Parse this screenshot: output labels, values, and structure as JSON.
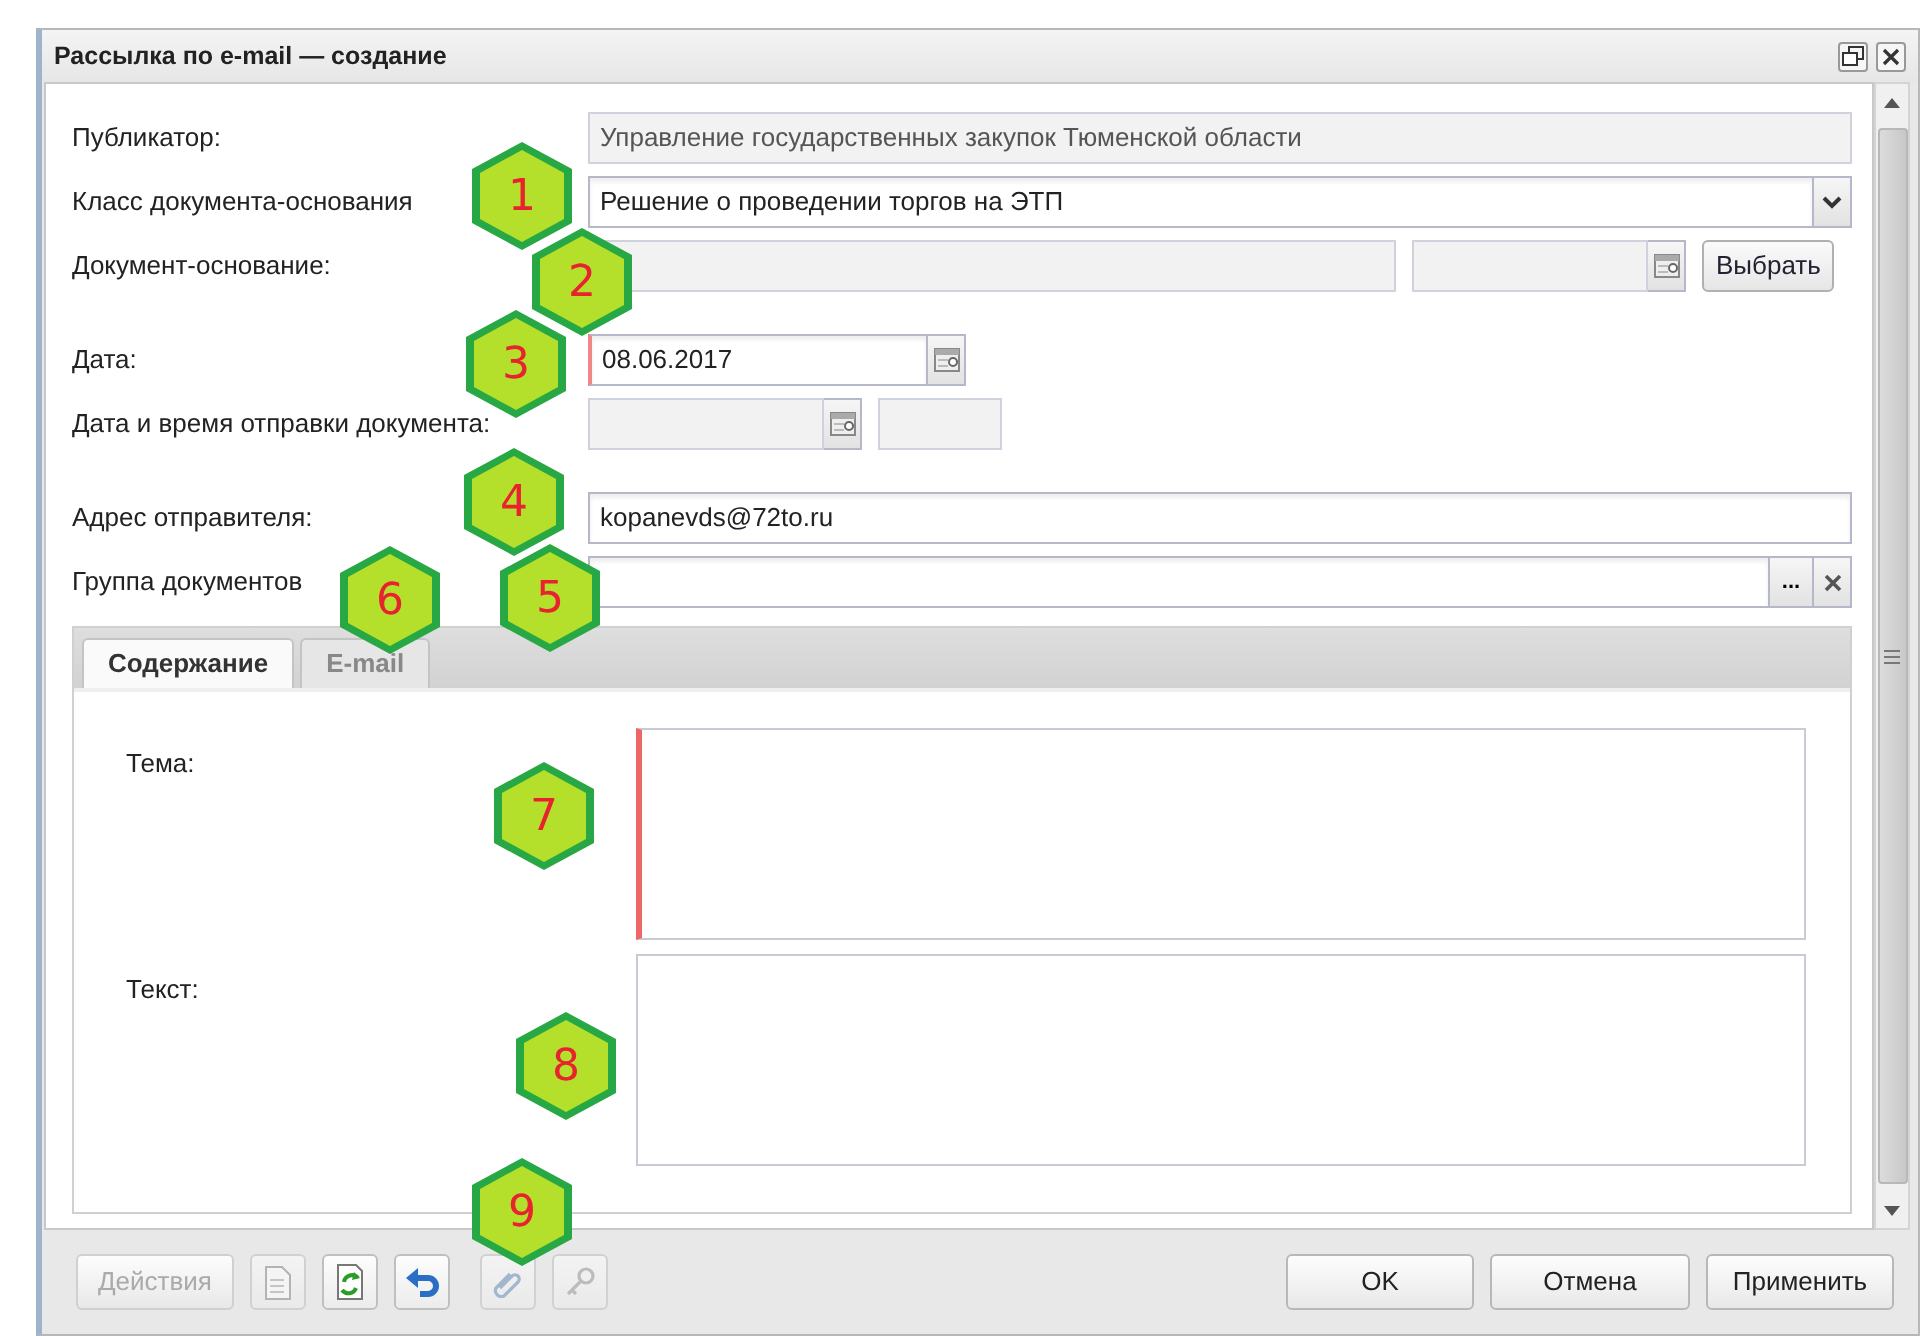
{
  "window": {
    "title": "Рассылка по e-mail — создание"
  },
  "fields": [
    {
      "kind": "readonly",
      "label": "Публикатор:",
      "value": "Управление государственных закупок Тюменской области"
    },
    {
      "kind": "combo",
      "label": "Класс документа-основания",
      "value": "Решение о проведении торгов на ЭТП"
    },
    {
      "kind": "document",
      "label": "Документ-основание:",
      "disabled": true,
      "button": "Выбрать"
    },
    {
      "kind": "date",
      "label": "Дата:",
      "value": "08.06.2017",
      "required": true
    },
    {
      "kind": "datetime",
      "label": "Дата и время отправки документа:",
      "disabled": true
    },
    {
      "kind": "text",
      "label": "Адрес отправителя:",
      "value": "kopanevds@72to.ru"
    },
    {
      "kind": "picker",
      "label": "Группа документов",
      "button": "..."
    }
  ],
  "tabs": [
    {
      "label": "Содержание",
      "selected": true
    },
    {
      "label": "E-mail",
      "selected": false
    }
  ],
  "content": [
    {
      "label": "Тема:",
      "required": true
    },
    {
      "label": "Текст:",
      "required": false
    }
  ],
  "toolbar": {
    "actions": {
      "label": "Действия",
      "disabled": true
    },
    "icons": [
      {
        "kind": "document",
        "disabled": true
      },
      {
        "kind": "refresh",
        "disabled": false
      },
      {
        "kind": "undo",
        "disabled": false
      },
      {
        "kind": "attach",
        "disabled": true
      },
      {
        "kind": "key",
        "disabled": true
      }
    ]
  },
  "buttons": [
    "OK",
    "Отмена",
    "Применить"
  ],
  "callouts": [
    "1",
    "2",
    "3",
    "4",
    "6",
    "5",
    "7",
    "8",
    "9"
  ]
}
